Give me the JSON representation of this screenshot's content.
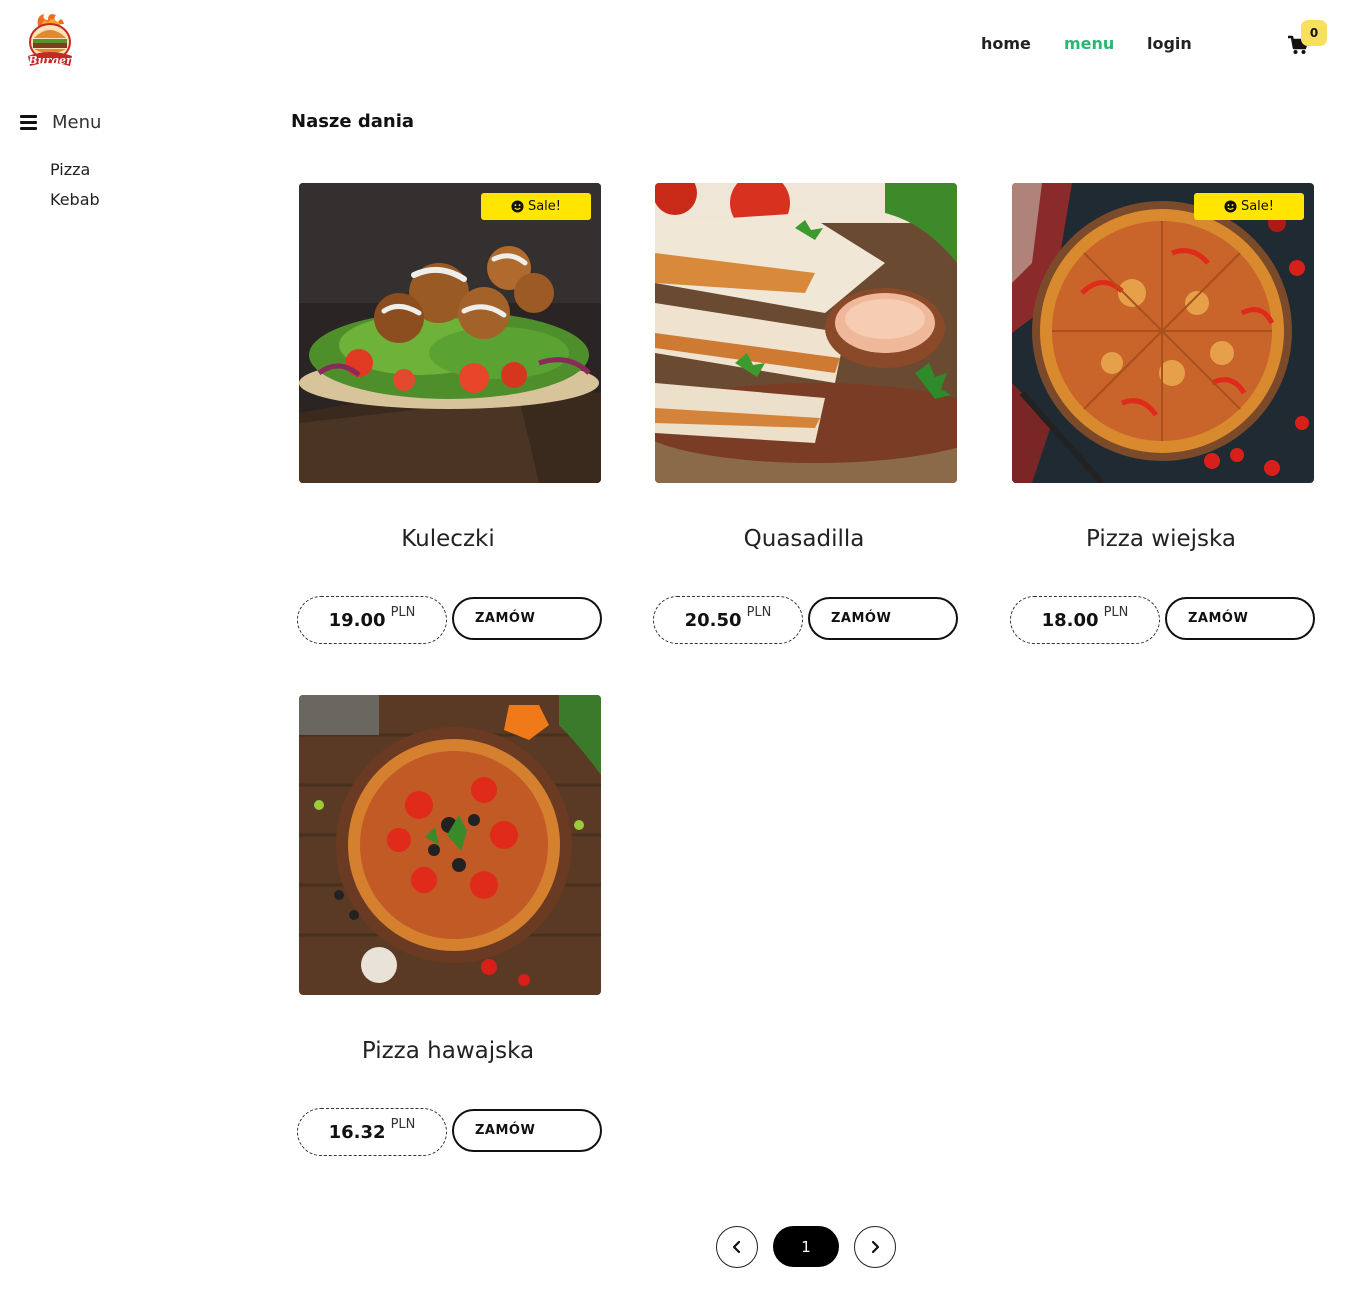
{
  "header": {
    "logo_icon": "burger-logo",
    "logo_text": "Burger",
    "nav": [
      {
        "label": "home"
      },
      {
        "label": "menu",
        "active": true
      },
      {
        "label": "login"
      }
    ],
    "cart_icon": "shopping-cart-icon",
    "cart_count": "0"
  },
  "sidebar": {
    "icon": "hamburger-icon",
    "title": "Menu",
    "items": [
      {
        "label": "Pizza"
      },
      {
        "label": "Kebab"
      }
    ]
  },
  "main": {
    "title": "Nasze dania",
    "order_label": "ZAMÓW",
    "products": [
      {
        "name": "Kuleczki",
        "price": "19.00",
        "currency": "PLN",
        "sale": true,
        "sale_label": "Sale!",
        "image": "falafel-salad-photo"
      },
      {
        "name": "Quasadilla",
        "price": "20.50",
        "currency": "PLN",
        "sale": false,
        "image": "quesadilla-photo"
      },
      {
        "name": "Pizza wiejska",
        "price": "18.00",
        "currency": "PLN",
        "sale": true,
        "sale_label": "Sale!",
        "image": "pepperoni-pizza-photo"
      },
      {
        "name": "Pizza hawajska",
        "price": "16.32",
        "currency": "PLN",
        "sale": false,
        "image": "pizza-on-wood-photo"
      }
    ]
  },
  "pagination": {
    "prev_icon": "chevron-left-icon",
    "current_page": "1",
    "next_icon": "chevron-right-icon"
  },
  "colors": {
    "accent": "#2bb673",
    "sale_badge": "#ffe500",
    "cart_badge": "#f6e05e"
  }
}
